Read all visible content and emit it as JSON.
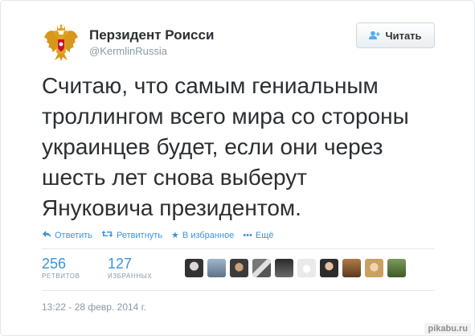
{
  "profile": {
    "name": "Перзидент Роисси",
    "handle": "@KermlinRussia"
  },
  "follow_button": {
    "label": "Читать"
  },
  "tweet": {
    "lines": [
      "Считаю, что самым гениальным",
      "троллингом всего мира со стороны",
      "украинцев будет, если они через",
      "шесть лет снова выберут",
      "Януковича президентом."
    ]
  },
  "actions": {
    "reply": "Ответить",
    "retweet": "Ретвитнуть",
    "favorite": "В избранное",
    "more": "Ещё"
  },
  "stats": {
    "retweets": {
      "count": "256",
      "label": "РЕТВИТОВ"
    },
    "favorites": {
      "count": "127",
      "label": "ИЗБРАННЫХ"
    }
  },
  "timestamp": "13:22 - 28 февр. 2014 г.",
  "watermark": "pikabu.ru",
  "colors": {
    "link_blue": "#3b94d9",
    "muted": "#8899a6",
    "text": "#292f33"
  },
  "icons": {
    "avatar": "russian-coat-of-arms",
    "follow": "add-user-icon",
    "reply": "reply-arrow-icon",
    "retweet": "retweet-icon",
    "favorite": "star-icon",
    "more": "ellipsis-icon"
  },
  "favoriter_count_shown": 10
}
